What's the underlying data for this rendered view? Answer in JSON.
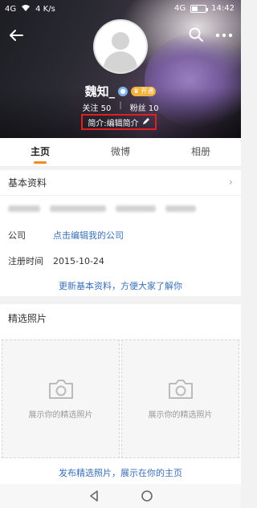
{
  "status": {
    "signal_left": "4G",
    "speed": "4 K/s",
    "right_badge": "4G",
    "time": "14:42"
  },
  "profile": {
    "name": "魏知_",
    "vip_badge": "开通",
    "follow_label": "关注",
    "follow_count": "50",
    "fans_label": "粉丝",
    "fans_count": "10",
    "bio": "简介:编辑简介"
  },
  "tabs": [
    {
      "label": "主页",
      "active": true
    },
    {
      "label": "微博",
      "active": false
    },
    {
      "label": "相册",
      "active": false
    }
  ],
  "basic_info": {
    "title": "基本资料",
    "company_label": "公司",
    "company_value": "点击编辑我的公司",
    "reg_label": "注册时间",
    "reg_value": "2015-10-24",
    "update_link": "更新基本资料，方便大家了解你"
  },
  "photos": {
    "title": "精选照片",
    "placeholder_1": "展示你的精选照片",
    "placeholder_2": "展示你的精选照片",
    "publish_link": "发布精选照片，展示在你的主页"
  },
  "colors": {
    "accent": "#f08a1c",
    "link": "#3a6fb7",
    "highlight_box": "#e02020"
  }
}
